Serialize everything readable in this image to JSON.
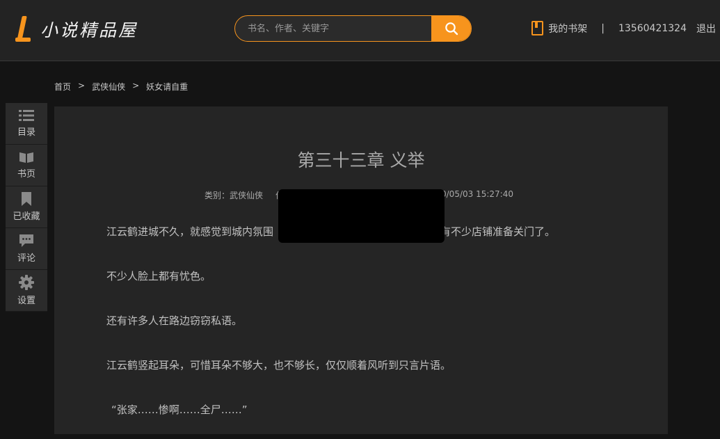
{
  "header": {
    "logo_text": "小说精品屋",
    "search_placeholder": "书名、作者、关键字",
    "bookshelf_label": "我的书架",
    "separator": "|",
    "phone": "13560421324",
    "logout_label": "退出",
    "accent_color": "#f7941d"
  },
  "breadcrumb": [
    "首页",
    "武侠仙侠",
    "妖女请自重"
  ],
  "sidebar": [
    {
      "icon": "list-icon",
      "label": "目录"
    },
    {
      "icon": "book-icon",
      "label": "书页"
    },
    {
      "icon": "bookmark-icon",
      "label": "已收藏"
    },
    {
      "icon": "comment-icon",
      "label": "评论"
    },
    {
      "icon": "gear-icon",
      "label": "设置"
    }
  ],
  "chapter": {
    "title": "第三十三章 义举",
    "category": "类别：武侠仙侠",
    "author_partial": "作",
    "time_partial": "0/05/03 15:27:40",
    "paragraphs": [
      "江云鹤进城不久，就感觉到城内氛围",
      "有不少店铺准备关门了。",
      "不少人脸上都有忧色。",
      "还有许多人在路边窃窃私语。",
      "江云鹤竖起耳朵，可惜耳朵不够大，也不够长，仅仅顺着风听到只言片语。",
      "“张家……惨啊……全尸……”"
    ]
  }
}
